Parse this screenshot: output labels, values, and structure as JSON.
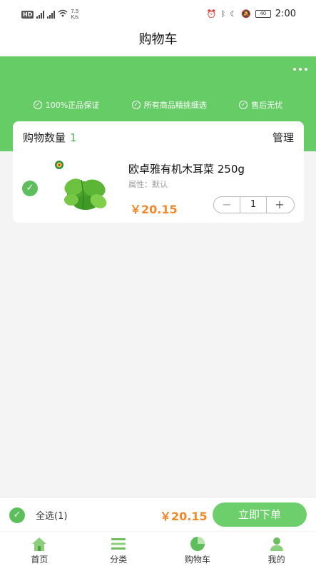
{
  "status_bar": {
    "left_hd": "HD",
    "signal1": "5G",
    "signal2": "3G",
    "speed_value": "7.5",
    "speed_unit": "K/s",
    "battery": "40",
    "time": "2:00"
  },
  "header": {
    "title": "购物车"
  },
  "banner": {
    "guarantees": [
      "100%正品保证",
      "所有商品精挑细选",
      "售后无忧"
    ],
    "colors": {
      "brand": "#66cc66",
      "price": "#f08a2c"
    }
  },
  "cart": {
    "count_label": "购物数量",
    "count": "1",
    "manage_label": "管理",
    "items": [
      {
        "name": "欧卓雅有机木耳菜 250g",
        "attr": "属性：默认",
        "price": "￥20.15",
        "quantity": "1",
        "checked": true
      }
    ]
  },
  "action_bar": {
    "select_all_label": "全选(1)",
    "total": "￥20.15",
    "order_button": "立即下单"
  },
  "tabs": [
    {
      "label": "首页",
      "icon": "home-icon"
    },
    {
      "label": "分类",
      "icon": "category-icon"
    },
    {
      "label": "购物车",
      "icon": "cart-icon",
      "active": true
    },
    {
      "label": "我的",
      "icon": "profile-icon"
    }
  ]
}
